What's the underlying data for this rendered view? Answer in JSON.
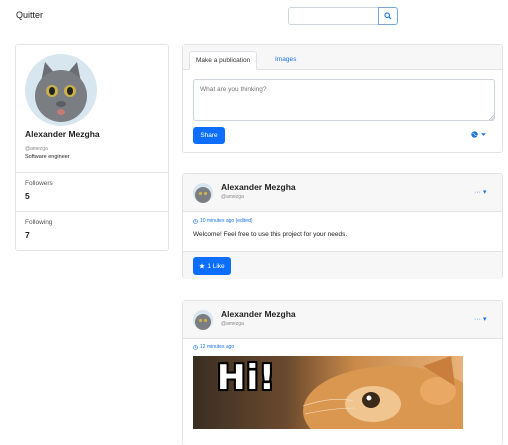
{
  "app": {
    "brand": "Quitter"
  },
  "search": {
    "placeholder": ""
  },
  "profile": {
    "name": "Alexander Mezgha",
    "handle": "@amezga",
    "role": "Software engineer",
    "stats": [
      {
        "label": "Followers",
        "value": "5"
      },
      {
        "label": "Following",
        "value": "7"
      }
    ]
  },
  "composer": {
    "tabs": [
      "Make a publication",
      "Images"
    ],
    "placeholder": "What are you thinking?",
    "share_label": "Share"
  },
  "posts": [
    {
      "author": "Alexander Mezgha",
      "handle": "@amezga",
      "time": "10 minutes ago (edited)",
      "text": "Welcome! Feel free to use this project for your needs.",
      "like_label": "1 Like",
      "menu": "··· ▾"
    },
    {
      "author": "Alexander Mezgha",
      "handle": "@amezga",
      "time": "12 minutes ago",
      "image_text": "Hi!",
      "menu": "··· ▾"
    }
  ],
  "icons": {
    "search": "search-icon",
    "globe": "globe-icon",
    "clock": "clock-icon",
    "star": "star-icon"
  },
  "colors": {
    "accent": "#0d6efd",
    "link": "#1a73e8",
    "panel": "#f7f7f7",
    "border": "#e3e3e3"
  }
}
